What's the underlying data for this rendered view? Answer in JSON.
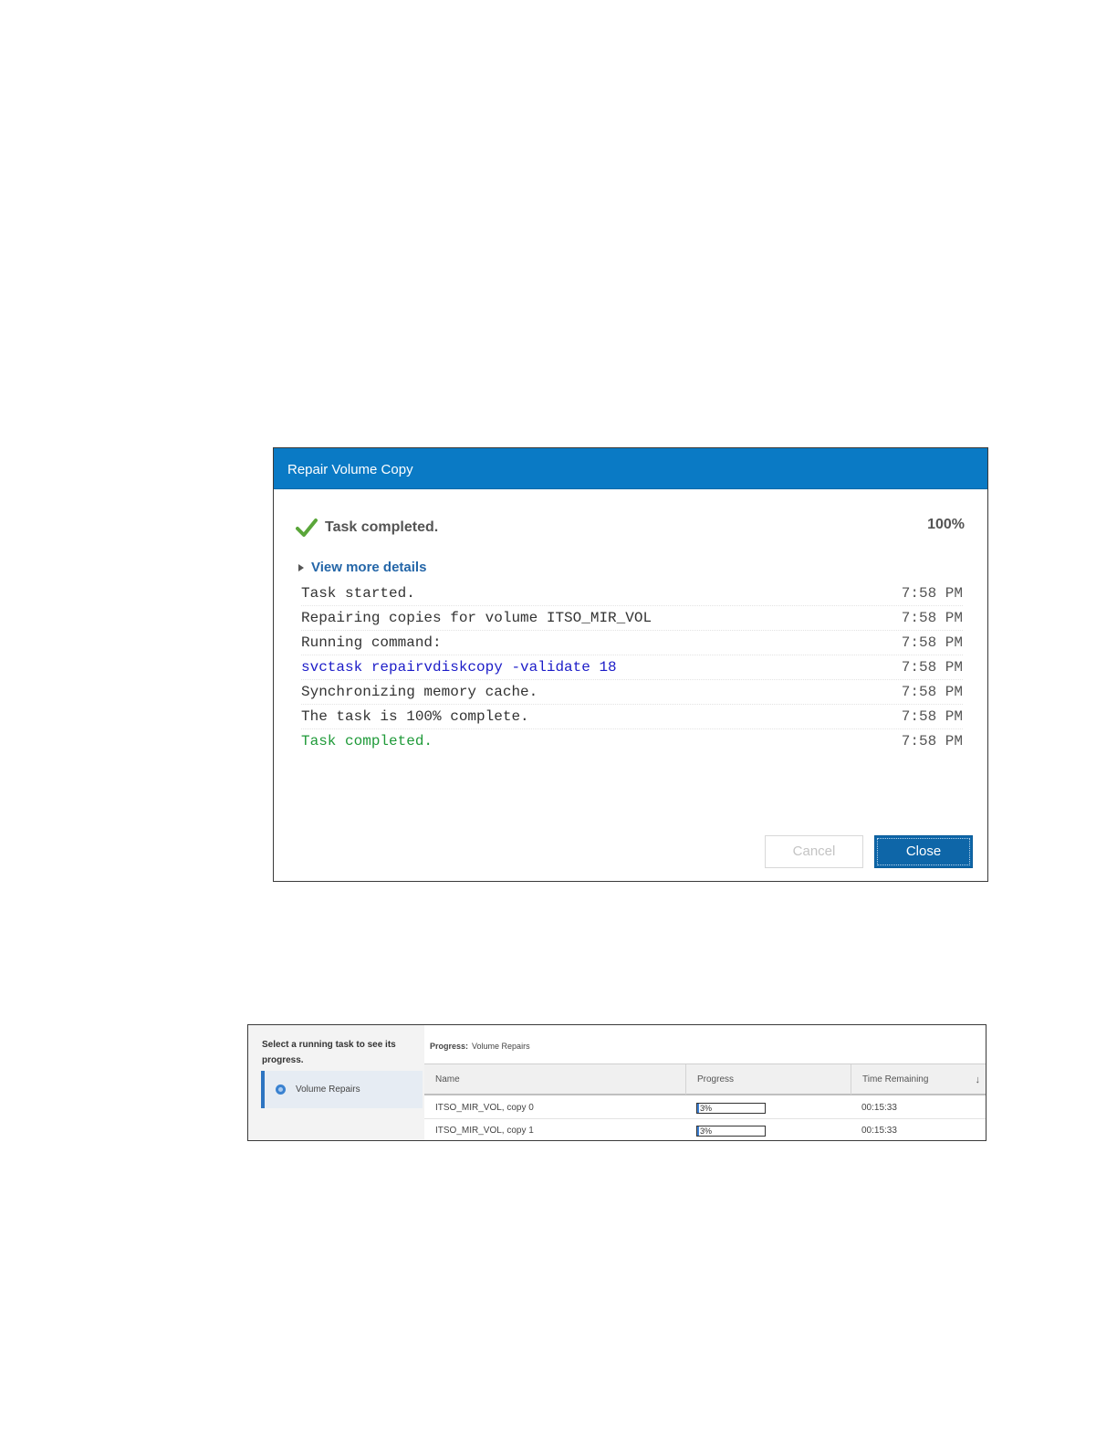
{
  "dialog": {
    "title": "Repair Volume Copy",
    "status": "Task completed.",
    "percent": "100%",
    "details_label": "View more details",
    "log": [
      {
        "message": "Task started.",
        "time": "7:58 PM",
        "kind": "normal"
      },
      {
        "message": "Repairing copies for volume ITSO_MIR_VOL",
        "time": "7:58 PM",
        "kind": "normal"
      },
      {
        "message": "Running command:",
        "time": "7:58 PM",
        "kind": "normal"
      },
      {
        "message": "svctask repairvdiskcopy -validate 18",
        "time": "7:58 PM",
        "kind": "command"
      },
      {
        "message": "Synchronizing memory cache.",
        "time": "7:58 PM",
        "kind": "normal"
      },
      {
        "message": "The task is 100% complete.",
        "time": "7:58 PM",
        "kind": "normal"
      },
      {
        "message": "Task completed.",
        "time": "7:58 PM",
        "kind": "success"
      }
    ],
    "cancel_label": "Cancel",
    "close_label": "Close",
    "colors": {
      "header": "#0a7ac5",
      "command": "#1c1cc8",
      "success": "#1f9a39",
      "checkmark": "#5aa63a"
    },
    "status_icon": "checkmark-icon"
  },
  "tasks": {
    "prompt": "Select a running task to see its progress.",
    "items": [
      {
        "label": "Volume Repairs",
        "icon": "running-task-icon"
      }
    ],
    "progress_label": "Progress:",
    "progress_value": "Volume Repairs",
    "columns": [
      "Name",
      "Progress",
      "Time Remaining"
    ],
    "sort_icon": "sort-descending-icon",
    "rows": [
      {
        "name": "ITSO_MIR_VOL, copy 0",
        "progress": 3,
        "progress_text": "3%",
        "time_remaining": "00:15:33"
      },
      {
        "name": "ITSO_MIR_VOL, copy 1",
        "progress": 3,
        "progress_text": "3%",
        "time_remaining": "00:15:33"
      }
    ]
  }
}
